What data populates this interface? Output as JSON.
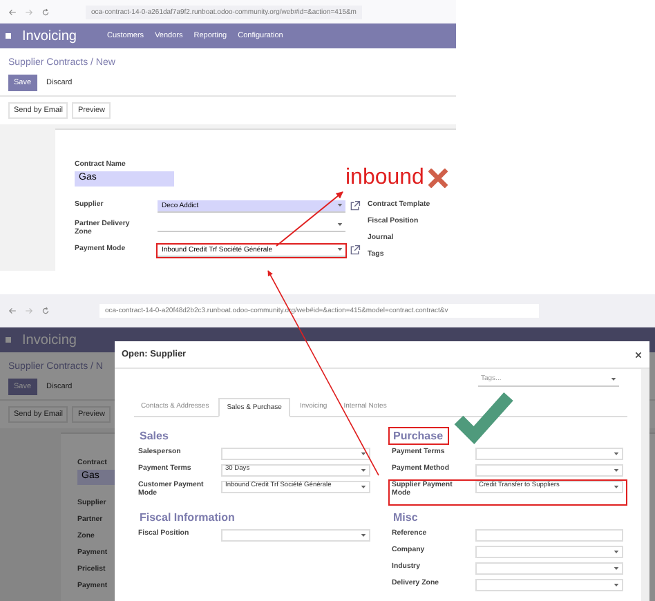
{
  "top_screenshot": {
    "browser": {
      "url": "oca-contract-14-0-a261daf7a9f2.runboat.odoo-community.org/web#id=&action=415&m"
    },
    "app_name": "Invoicing",
    "menu": [
      "Customers",
      "Vendors",
      "Reporting",
      "Configuration"
    ],
    "breadcrumb": "Supplier Contracts / New",
    "buttons": [
      "Save",
      "Discard"
    ],
    "actions": [
      "Send by Email",
      "Preview"
    ],
    "contract_name": {
      "label": "Contract Name",
      "value": "Gas"
    },
    "left_fields": [
      {
        "label": "Supplier",
        "value": "Deco Addict",
        "required": true,
        "external_link": true,
        "highlighted": false
      },
      {
        "label": "Partner Delivery Zone",
        "required": false,
        "external_link": false,
        "highlighted": false
      },
      {
        "label": "Payment Mode",
        "value": "Inbound Credit Trf Société Générale",
        "required": false,
        "external_link": true,
        "highlighted": true
      }
    ],
    "right_labels": [
      "Contract Template",
      "Fiscal Position",
      "Journal",
      "Tags"
    ]
  },
  "annotation": {
    "wrong_label": "inbound"
  },
  "bottom_screenshot": {
    "browser": {
      "url": "oca-contract-14-0-a20f48d2b2c3.runboat.odoo-community.org/web#id=&action=415&model=contract.contract&v"
    },
    "app_name": "Invoicing",
    "background": {
      "breadcrumb": "Supplier Contracts / N",
      "buttons": [
        "Save",
        "Discard"
      ],
      "actions": [
        "Send by Email",
        "Preview"
      ],
      "contract_label": "Contract",
      "contract_value": "Gas",
      "labels": [
        "Supplier",
        "Partner",
        "Zone",
        "Payment",
        "Pricelist",
        "Payment"
      ]
    },
    "dialog": {
      "title": "Open: Supplier",
      "tags_placeholder": "Tags...",
      "tabs": [
        {
          "label": "Contacts & Addresses",
          "selected": false
        },
        {
          "label": "Sales & Purchase",
          "selected": true
        },
        {
          "label": "Invoicing",
          "selected": false
        },
        {
          "label": "Internal Notes",
          "selected": false
        }
      ],
      "sections": [
        {
          "title": "Sales",
          "highlighted": false,
          "fields": [
            {
              "label": "Salesperson",
              "kind": "select",
              "highlighted": false
            },
            {
              "label": "Payment Terms",
              "value": "30 Days",
              "kind": "select",
              "highlighted": false
            },
            {
              "label": "Customer Payment Mode",
              "value": "Inbound Credit Trf Société Générale",
              "kind": "select",
              "highlighted": false
            }
          ]
        },
        {
          "title": "Purchase",
          "highlighted": true,
          "fields": [
            {
              "label": "Payment Terms",
              "kind": "select",
              "highlighted": false
            },
            {
              "label": "Payment Method",
              "kind": "select",
              "highlighted": false
            },
            {
              "label": "Supplier Payment Mode",
              "value": "Credit Transfer to Suppliers",
              "kind": "select",
              "highlighted": true
            }
          ]
        },
        {
          "title": "Fiscal Information",
          "highlighted": false,
          "fields": [
            {
              "label": "Fiscal Position",
              "kind": "select",
              "highlighted": false
            }
          ]
        },
        {
          "title": "Misc",
          "highlighted": false,
          "fields": [
            {
              "label": "Reference",
              "kind": "text",
              "highlighted": false
            },
            {
              "label": "Company",
              "kind": "select",
              "highlighted": false
            },
            {
              "label": "Industry",
              "kind": "select",
              "highlighted": false
            },
            {
              "label": "Delivery Zone",
              "kind": "select",
              "highlighted": false
            }
          ]
        }
      ]
    }
  }
}
